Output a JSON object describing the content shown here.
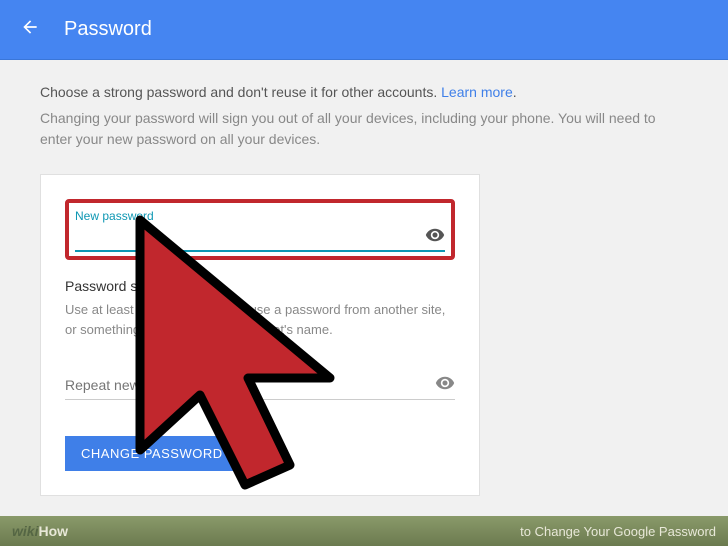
{
  "header": {
    "title": "Password"
  },
  "intro": {
    "line1_prefix": "Choose a strong password and don't reuse it for other accounts. ",
    "learn_more": "Learn more",
    "line1_suffix": ".",
    "line2": "Changing your password will sign you out of all your devices, including your phone. You will need to enter your new password on all your devices."
  },
  "form": {
    "new_password_label": "New password",
    "new_password_value": "",
    "strength_title": "Password strength:",
    "strength_text": "Use at least 8 characters. Don't use a password from another site, or something too obvious like your pet's name.",
    "repeat_placeholder": "Repeat new password",
    "change_button": "CHANGE PASSWORD"
  },
  "footer": {
    "brand_wiki": "wiki",
    "brand_how": "How",
    "caption": " to Change Your Google Password"
  }
}
